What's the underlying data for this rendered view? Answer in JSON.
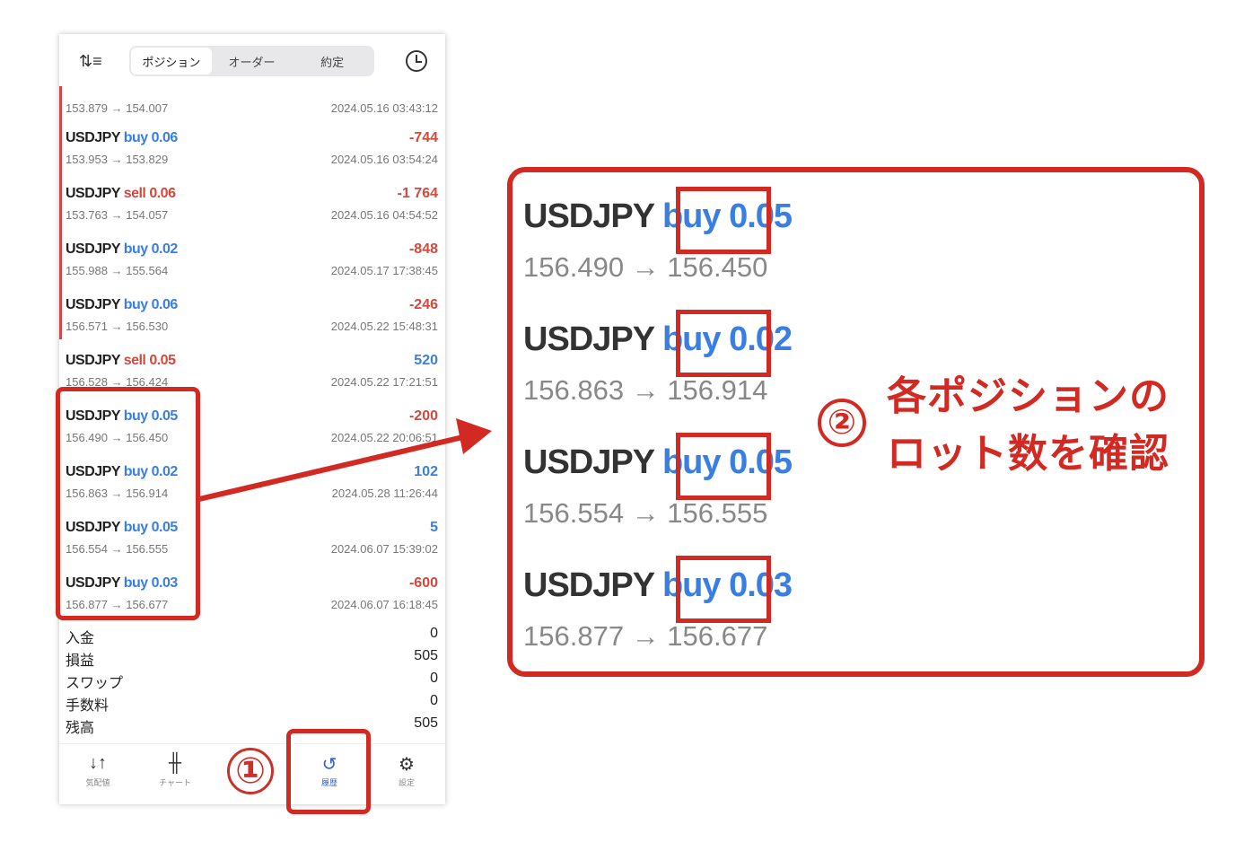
{
  "header": {
    "tabs": [
      "ポジション",
      "オーダー",
      "約定"
    ],
    "active_tab": 0,
    "sort_icon": "sort-icon",
    "history_icon": "clock-icon"
  },
  "trades": [
    {
      "symbol": "USDJPY",
      "side": "buy",
      "lot": "0.06",
      "prices": "153.953 → 153.829",
      "pl": "-744",
      "time": "2024.05.16 03:54:24"
    },
    {
      "symbol": "USDJPY",
      "side": "sell",
      "lot": "0.06",
      "prices": "153.763 → 154.057",
      "pl": "-1 764",
      "time": "2024.05.16 04:54:52"
    },
    {
      "symbol": "USDJPY",
      "side": "buy",
      "lot": "0.02",
      "prices": "155.988 → 155.564",
      "pl": "-848",
      "time": "2024.05.17 17:38:45"
    },
    {
      "symbol": "USDJPY",
      "side": "buy",
      "lot": "0.06",
      "prices": "156.571 → 156.530",
      "pl": "-246",
      "time": "2024.05.22 15:48:31"
    },
    {
      "symbol": "USDJPY",
      "side": "sell",
      "lot": "0.05",
      "prices": "156.528 → 156.424",
      "pl": "520",
      "time": "2024.05.22 17:21:51"
    },
    {
      "symbol": "USDJPY",
      "side": "buy",
      "lot": "0.05",
      "prices": "156.490 → 156.450",
      "pl": "-200",
      "time": "2024.05.22 20:06:51"
    },
    {
      "symbol": "USDJPY",
      "side": "buy",
      "lot": "0.02",
      "prices": "156.863 → 156.914",
      "pl": "102",
      "time": "2024.05.28 11:26:44"
    },
    {
      "symbol": "USDJPY",
      "side": "buy",
      "lot": "0.05",
      "prices": "156.554 → 156.555",
      "pl": "5",
      "time": "2024.06.07 15:39:02"
    },
    {
      "symbol": "USDJPY",
      "side": "buy",
      "lot": "0.03",
      "prices": "156.877 → 156.677",
      "pl": "-600",
      "time": "2024.06.07 16:18:45"
    }
  ],
  "partial_row": {
    "prices": "153.879 → 154.007",
    "time": "2024.05.16 03:43:12"
  },
  "summary": [
    {
      "k": "入金",
      "v": "0"
    },
    {
      "k": "損益",
      "v": "505"
    },
    {
      "k": "スワップ",
      "v": "0"
    },
    {
      "k": "手数料",
      "v": "0"
    },
    {
      "k": "残高",
      "v": "505"
    }
  ],
  "nav": [
    {
      "label": "気配値",
      "icon": "quotes-icon"
    },
    {
      "label": "チャート",
      "icon": "chart-icon"
    },
    {
      "label": "",
      "icon": "trade-icon"
    },
    {
      "label": "履歴",
      "icon": "history-icon",
      "active": true
    },
    {
      "label": "設定",
      "icon": "settings-icon"
    }
  ],
  "annotations": {
    "step1": "①",
    "step2": "②",
    "note_line1": "各ポジションの",
    "note_line2": "ロット数を確認"
  },
  "colors": {
    "buy": "#3a7fe0",
    "sell": "#d6473c",
    "loss": "#d6473c",
    "profit": "#3a7fe0",
    "highlight": "#d22a22"
  }
}
